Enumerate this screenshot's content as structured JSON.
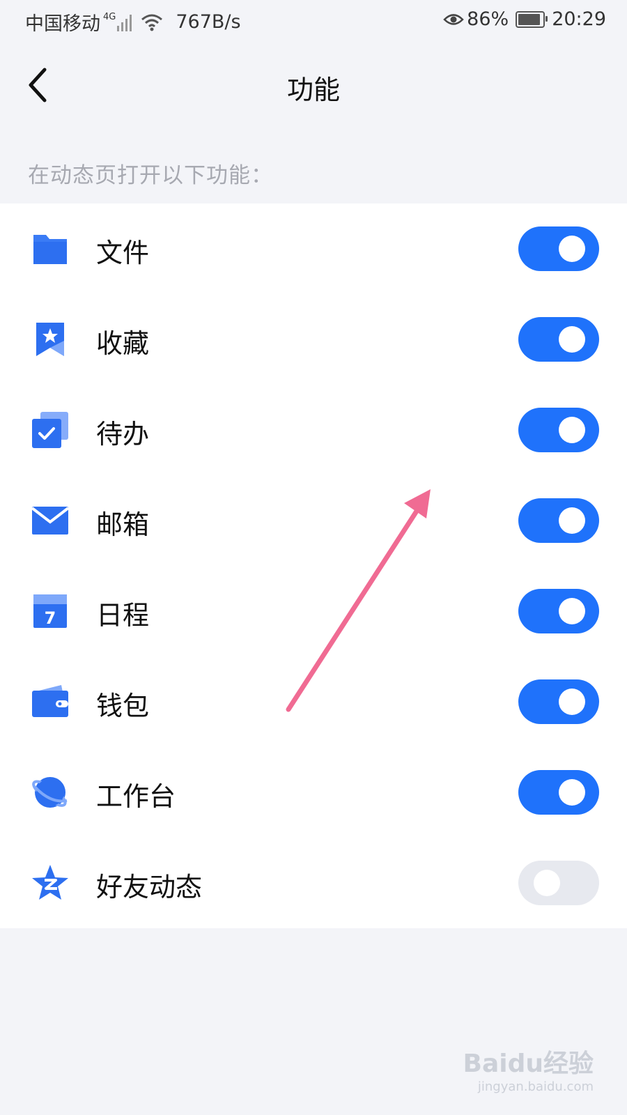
{
  "status": {
    "carrier": "中国移动",
    "net": "4G",
    "speed": "767B/s",
    "battery_pct": "86%",
    "time": "20:29"
  },
  "header": {
    "title": "功能"
  },
  "section_label": "在动态页打开以下功能：",
  "items": [
    {
      "label": "文件",
      "icon": "folder-icon",
      "enabled": true
    },
    {
      "label": "收藏",
      "icon": "bookmark-star-icon",
      "enabled": true
    },
    {
      "label": "待办",
      "icon": "todo-check-icon",
      "enabled": true
    },
    {
      "label": "邮箱",
      "icon": "mail-icon",
      "enabled": true
    },
    {
      "label": "日程",
      "icon": "calendar-icon",
      "enabled": true
    },
    {
      "label": "钱包",
      "icon": "wallet-icon",
      "enabled": true
    },
    {
      "label": "工作台",
      "icon": "planet-icon",
      "enabled": true
    },
    {
      "label": "好友动态",
      "icon": "qzone-star-icon",
      "enabled": false
    }
  ],
  "colors": {
    "accent": "#1f72fb",
    "toggle_off": "#e7e9ef",
    "arrow": "#f06b93"
  },
  "watermark": {
    "logo": "Baidu经验",
    "sub": "jingyan.baidu.com"
  }
}
